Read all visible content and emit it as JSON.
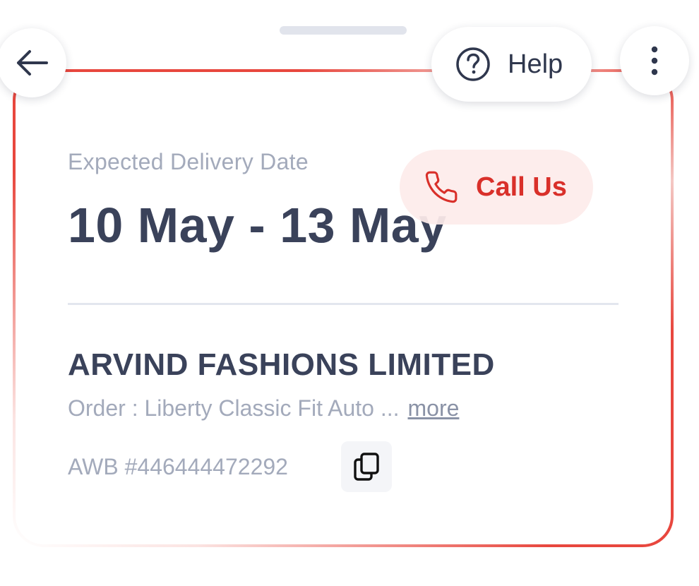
{
  "header": {
    "help_label": "Help",
    "icons": {
      "back": "arrow-left-icon",
      "help": "question-circle-icon",
      "more": "more-vertical-icon"
    }
  },
  "delivery": {
    "label": "Expected Delivery Date",
    "date_range": "10 May - 13 May"
  },
  "call": {
    "label": "Call Us",
    "icon": "phone-icon",
    "color": "#d9302a",
    "background": "#fdeceb"
  },
  "shipment": {
    "company": "ARVIND FASHIONS LIMITED",
    "order_text": "Order : Liberty Classic Fit Auto ...",
    "more_label": "more",
    "awb_text": "AWB #446444472292",
    "copy_icon": "copy-icon"
  },
  "colors": {
    "accent": "#e8473e",
    "text_primary": "#3a425a",
    "text_muted": "#a3aabb"
  }
}
